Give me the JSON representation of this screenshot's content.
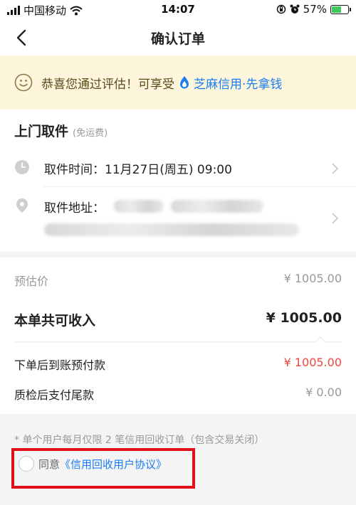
{
  "status_bar": {
    "carrier": "中国移动",
    "time": "14:07",
    "battery": "57%",
    "battery_level": 0.57
  },
  "nav": {
    "title": "确认订单"
  },
  "banner": {
    "text": "恭喜您通过评估！可享受",
    "link": "芝麻信用·先拿钱"
  },
  "pickup": {
    "title": "上门取件",
    "subtitle": "(免运费)",
    "time_label": "取件时间：",
    "time_value": "11月27日(周五) 09:00",
    "address_label": "取件地址："
  },
  "pricing": {
    "estimate_label": "预估价",
    "estimate_value": "¥ 1005.00",
    "total_label": "本单共可收入",
    "total_value": "¥ 1005.00",
    "prepay_label": "下单后到账预付款",
    "prepay_value": "¥ 1005.00",
    "final_label": "质检后支付尾款",
    "final_value": "¥ 0.00"
  },
  "footer": {
    "note": "* 单个用户每月仅限 2 笔信用回收订单（包含交易关闭）",
    "agree_text": "同意",
    "agreement_link": "《信用回收用户协议》"
  }
}
